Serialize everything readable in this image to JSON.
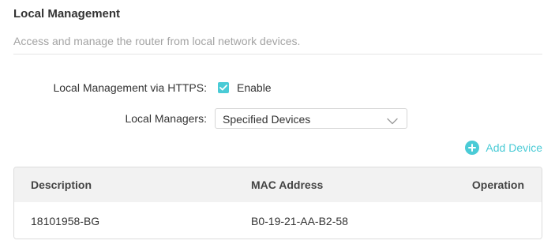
{
  "section": {
    "title": "Local Management",
    "description": "Access and manage the router from local network devices."
  },
  "https": {
    "label": "Local Management via HTTPS:",
    "checkbox_label": "Enable",
    "checked": true
  },
  "managers": {
    "label": "Local Managers:",
    "selected": "Specified Devices"
  },
  "add_device": {
    "label": "Add Device"
  },
  "table": {
    "headers": {
      "description": "Description",
      "mac": "MAC Address",
      "operation": "Operation"
    },
    "rows": [
      {
        "description": "18101958-BG",
        "mac": "B0-19-21-AA-B2-58",
        "operation": ""
      }
    ]
  },
  "colors": {
    "accent": "#4acbd6",
    "header_bg": "#f2f2f2",
    "muted_text": "#a3a3a3"
  },
  "icons": {
    "checkbox": "check-icon",
    "select": "chevron-down-icon",
    "add": "plus-circle-icon"
  }
}
